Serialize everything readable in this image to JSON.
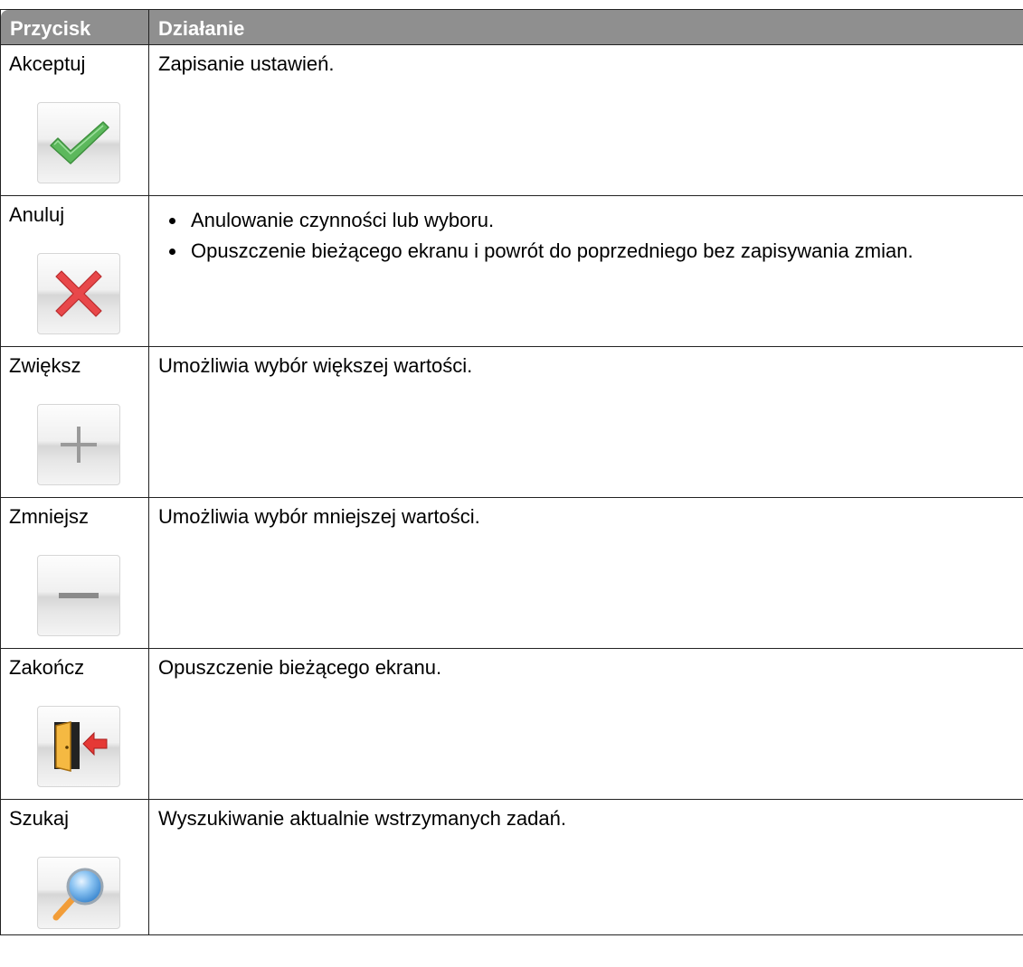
{
  "table": {
    "headers": {
      "button": "Przycisk",
      "action": "Działanie"
    },
    "rows": [
      {
        "label": "Akceptuj",
        "icon": "checkmark-icon",
        "description": "Zapisanie ustawień."
      },
      {
        "label": "Anuluj",
        "icon": "cancel-x-icon",
        "bullets": [
          "Anulowanie czynności lub wyboru.",
          "Opuszczenie bieżącego ekranu i powrót do poprzedniego bez zapisywania zmian."
        ]
      },
      {
        "label": "Zwiększ",
        "icon": "plus-icon",
        "description": "Umożliwia wybór większej wartości."
      },
      {
        "label": "Zmniejsz",
        "icon": "minus-icon",
        "description": "Umożliwia wybór mniejszej wartości."
      },
      {
        "label": "Zakończ",
        "icon": "exit-door-icon",
        "description": "Opuszczenie bieżącego ekranu."
      },
      {
        "label": "Szukaj",
        "icon": "magnifier-icon",
        "description": "Wyszukiwanie aktualnie wstrzymanych zadań."
      }
    ]
  },
  "colors": {
    "header_bg": "#8f8f8f",
    "check_green": "#5cb85c",
    "cancel_red": "#e8484a",
    "exit_arrow_red": "#e53935",
    "door_orange": "#f5b942",
    "magnifier_blue": "#5fa8e6",
    "magnifier_handle": "#f29d38"
  }
}
